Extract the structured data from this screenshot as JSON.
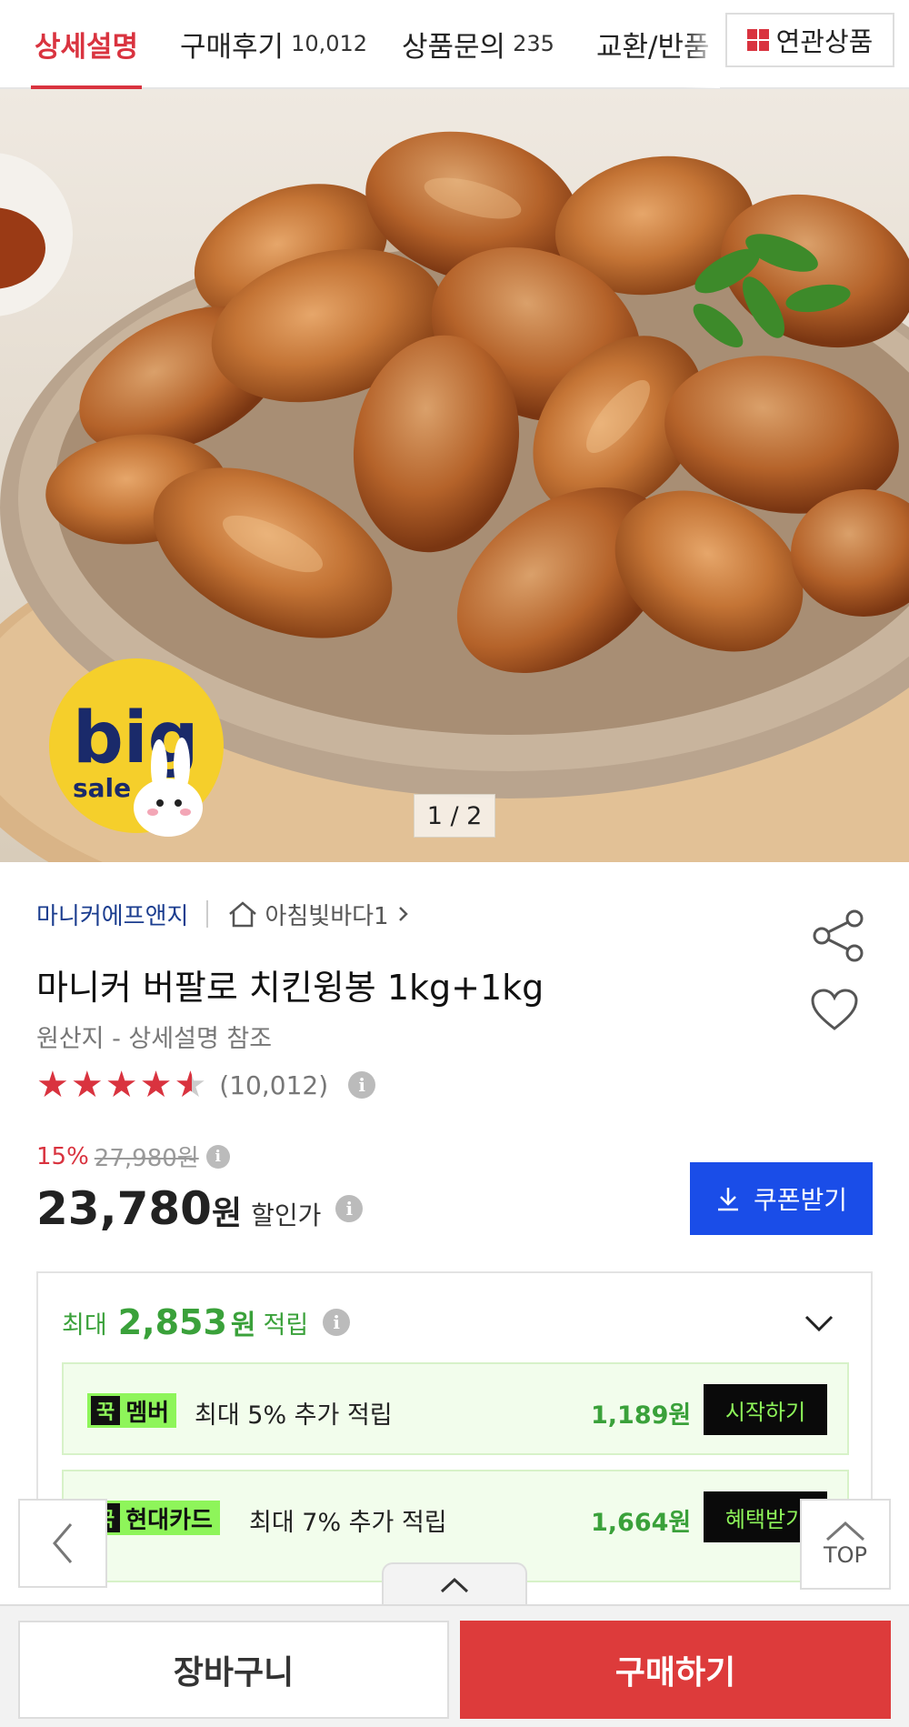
{
  "tabs": [
    {
      "label": "상세설명",
      "count": ""
    },
    {
      "label": "구매후기",
      "count": "10,012"
    },
    {
      "label": "상품문의",
      "count": "235"
    },
    {
      "label": "교환/반품",
      "count": ""
    }
  ],
  "related_label": "연관상품",
  "image": {
    "pager": "1 / 2",
    "badge_big": "big",
    "badge_sale": "sale"
  },
  "product": {
    "seller": "마니커에프앤지",
    "store": "아침빛바다1",
    "title": "마니커 버팔로 치킨윙봉 1kg+1kg",
    "origin": "원산지 - 상세설명 참조",
    "rating_value": 4.5,
    "review_count": "(10,012)"
  },
  "price": {
    "discount": "15%",
    "original": "27,980원",
    "sale": "23,780",
    "won": "원",
    "sale_label": "할인가",
    "coupon_label": "쿠폰받기"
  },
  "points": {
    "prefix": "최대",
    "amount": "2,853",
    "won": "원",
    "suffix": "적립",
    "benefits": [
      {
        "mark": "꾹",
        "tag": "멤버",
        "text": "최대 5% 추가 적립",
        "amount": "1,189",
        "won": "원",
        "button": "시작하기"
      },
      {
        "mark": "꾹",
        "tag": "현대카드",
        "text": "최대 7% 추가 적립",
        "amount": "1,664",
        "won": "원",
        "button": "혜택받기"
      }
    ]
  },
  "floating": {
    "top_label": "TOP"
  },
  "bottom": {
    "cart": "장바구니",
    "buy": "구매하기"
  },
  "colors": {
    "accent_red": "#d9333f",
    "coupon_blue": "#1a4de8",
    "points_green": "#3aa13a",
    "badge_green": "#8ef55a"
  }
}
